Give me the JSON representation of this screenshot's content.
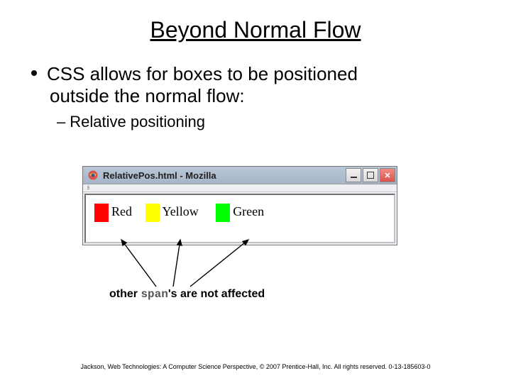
{
  "title": "Beyond Normal Flow",
  "bullet_main_line1": "CSS allows for boxes to be positioned",
  "bullet_main_line2": "outside the normal flow:",
  "bullet_sub": "Relative positioning",
  "browser": {
    "window_title": "RelativePos.html - Mozilla",
    "spans": {
      "red": "Red",
      "yellow": "Yellow",
      "green": "Green"
    }
  },
  "caption_prefix": "other ",
  "caption_code": "span",
  "caption_suffix": "'s are not affected",
  "footer": "Jackson, Web Technologies: A Computer Science Perspective, © 2007 Prentice-Hall, Inc. All rights reserved. 0-13-185603-0"
}
